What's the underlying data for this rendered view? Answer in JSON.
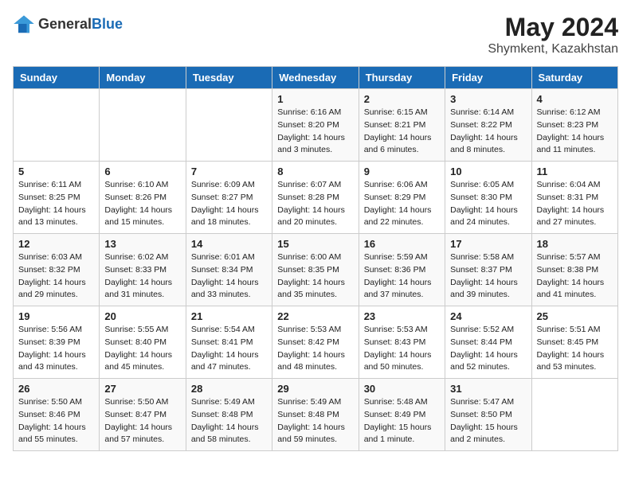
{
  "header": {
    "logo_general": "General",
    "logo_blue": "Blue",
    "month_year": "May 2024",
    "location": "Shymkent, Kazakhstan"
  },
  "days_of_week": [
    "Sunday",
    "Monday",
    "Tuesday",
    "Wednesday",
    "Thursday",
    "Friday",
    "Saturday"
  ],
  "weeks": [
    [
      {
        "day": "",
        "info": ""
      },
      {
        "day": "",
        "info": ""
      },
      {
        "day": "",
        "info": ""
      },
      {
        "day": "1",
        "info": "Sunrise: 6:16 AM\nSunset: 8:20 PM\nDaylight: 14 hours\nand 3 minutes."
      },
      {
        "day": "2",
        "info": "Sunrise: 6:15 AM\nSunset: 8:21 PM\nDaylight: 14 hours\nand 6 minutes."
      },
      {
        "day": "3",
        "info": "Sunrise: 6:14 AM\nSunset: 8:22 PM\nDaylight: 14 hours\nand 8 minutes."
      },
      {
        "day": "4",
        "info": "Sunrise: 6:12 AM\nSunset: 8:23 PM\nDaylight: 14 hours\nand 11 minutes."
      }
    ],
    [
      {
        "day": "5",
        "info": "Sunrise: 6:11 AM\nSunset: 8:25 PM\nDaylight: 14 hours\nand 13 minutes."
      },
      {
        "day": "6",
        "info": "Sunrise: 6:10 AM\nSunset: 8:26 PM\nDaylight: 14 hours\nand 15 minutes."
      },
      {
        "day": "7",
        "info": "Sunrise: 6:09 AM\nSunset: 8:27 PM\nDaylight: 14 hours\nand 18 minutes."
      },
      {
        "day": "8",
        "info": "Sunrise: 6:07 AM\nSunset: 8:28 PM\nDaylight: 14 hours\nand 20 minutes."
      },
      {
        "day": "9",
        "info": "Sunrise: 6:06 AM\nSunset: 8:29 PM\nDaylight: 14 hours\nand 22 minutes."
      },
      {
        "day": "10",
        "info": "Sunrise: 6:05 AM\nSunset: 8:30 PM\nDaylight: 14 hours\nand 24 minutes."
      },
      {
        "day": "11",
        "info": "Sunrise: 6:04 AM\nSunset: 8:31 PM\nDaylight: 14 hours\nand 27 minutes."
      }
    ],
    [
      {
        "day": "12",
        "info": "Sunrise: 6:03 AM\nSunset: 8:32 PM\nDaylight: 14 hours\nand 29 minutes."
      },
      {
        "day": "13",
        "info": "Sunrise: 6:02 AM\nSunset: 8:33 PM\nDaylight: 14 hours\nand 31 minutes."
      },
      {
        "day": "14",
        "info": "Sunrise: 6:01 AM\nSunset: 8:34 PM\nDaylight: 14 hours\nand 33 minutes."
      },
      {
        "day": "15",
        "info": "Sunrise: 6:00 AM\nSunset: 8:35 PM\nDaylight: 14 hours\nand 35 minutes."
      },
      {
        "day": "16",
        "info": "Sunrise: 5:59 AM\nSunset: 8:36 PM\nDaylight: 14 hours\nand 37 minutes."
      },
      {
        "day": "17",
        "info": "Sunrise: 5:58 AM\nSunset: 8:37 PM\nDaylight: 14 hours\nand 39 minutes."
      },
      {
        "day": "18",
        "info": "Sunrise: 5:57 AM\nSunset: 8:38 PM\nDaylight: 14 hours\nand 41 minutes."
      }
    ],
    [
      {
        "day": "19",
        "info": "Sunrise: 5:56 AM\nSunset: 8:39 PM\nDaylight: 14 hours\nand 43 minutes."
      },
      {
        "day": "20",
        "info": "Sunrise: 5:55 AM\nSunset: 8:40 PM\nDaylight: 14 hours\nand 45 minutes."
      },
      {
        "day": "21",
        "info": "Sunrise: 5:54 AM\nSunset: 8:41 PM\nDaylight: 14 hours\nand 47 minutes."
      },
      {
        "day": "22",
        "info": "Sunrise: 5:53 AM\nSunset: 8:42 PM\nDaylight: 14 hours\nand 48 minutes."
      },
      {
        "day": "23",
        "info": "Sunrise: 5:53 AM\nSunset: 8:43 PM\nDaylight: 14 hours\nand 50 minutes."
      },
      {
        "day": "24",
        "info": "Sunrise: 5:52 AM\nSunset: 8:44 PM\nDaylight: 14 hours\nand 52 minutes."
      },
      {
        "day": "25",
        "info": "Sunrise: 5:51 AM\nSunset: 8:45 PM\nDaylight: 14 hours\nand 53 minutes."
      }
    ],
    [
      {
        "day": "26",
        "info": "Sunrise: 5:50 AM\nSunset: 8:46 PM\nDaylight: 14 hours\nand 55 minutes."
      },
      {
        "day": "27",
        "info": "Sunrise: 5:50 AM\nSunset: 8:47 PM\nDaylight: 14 hours\nand 57 minutes."
      },
      {
        "day": "28",
        "info": "Sunrise: 5:49 AM\nSunset: 8:48 PM\nDaylight: 14 hours\nand 58 minutes."
      },
      {
        "day": "29",
        "info": "Sunrise: 5:49 AM\nSunset: 8:48 PM\nDaylight: 14 hours\nand 59 minutes."
      },
      {
        "day": "30",
        "info": "Sunrise: 5:48 AM\nSunset: 8:49 PM\nDaylight: 15 hours\nand 1 minute."
      },
      {
        "day": "31",
        "info": "Sunrise: 5:47 AM\nSunset: 8:50 PM\nDaylight: 15 hours\nand 2 minutes."
      },
      {
        "day": "",
        "info": ""
      }
    ]
  ]
}
